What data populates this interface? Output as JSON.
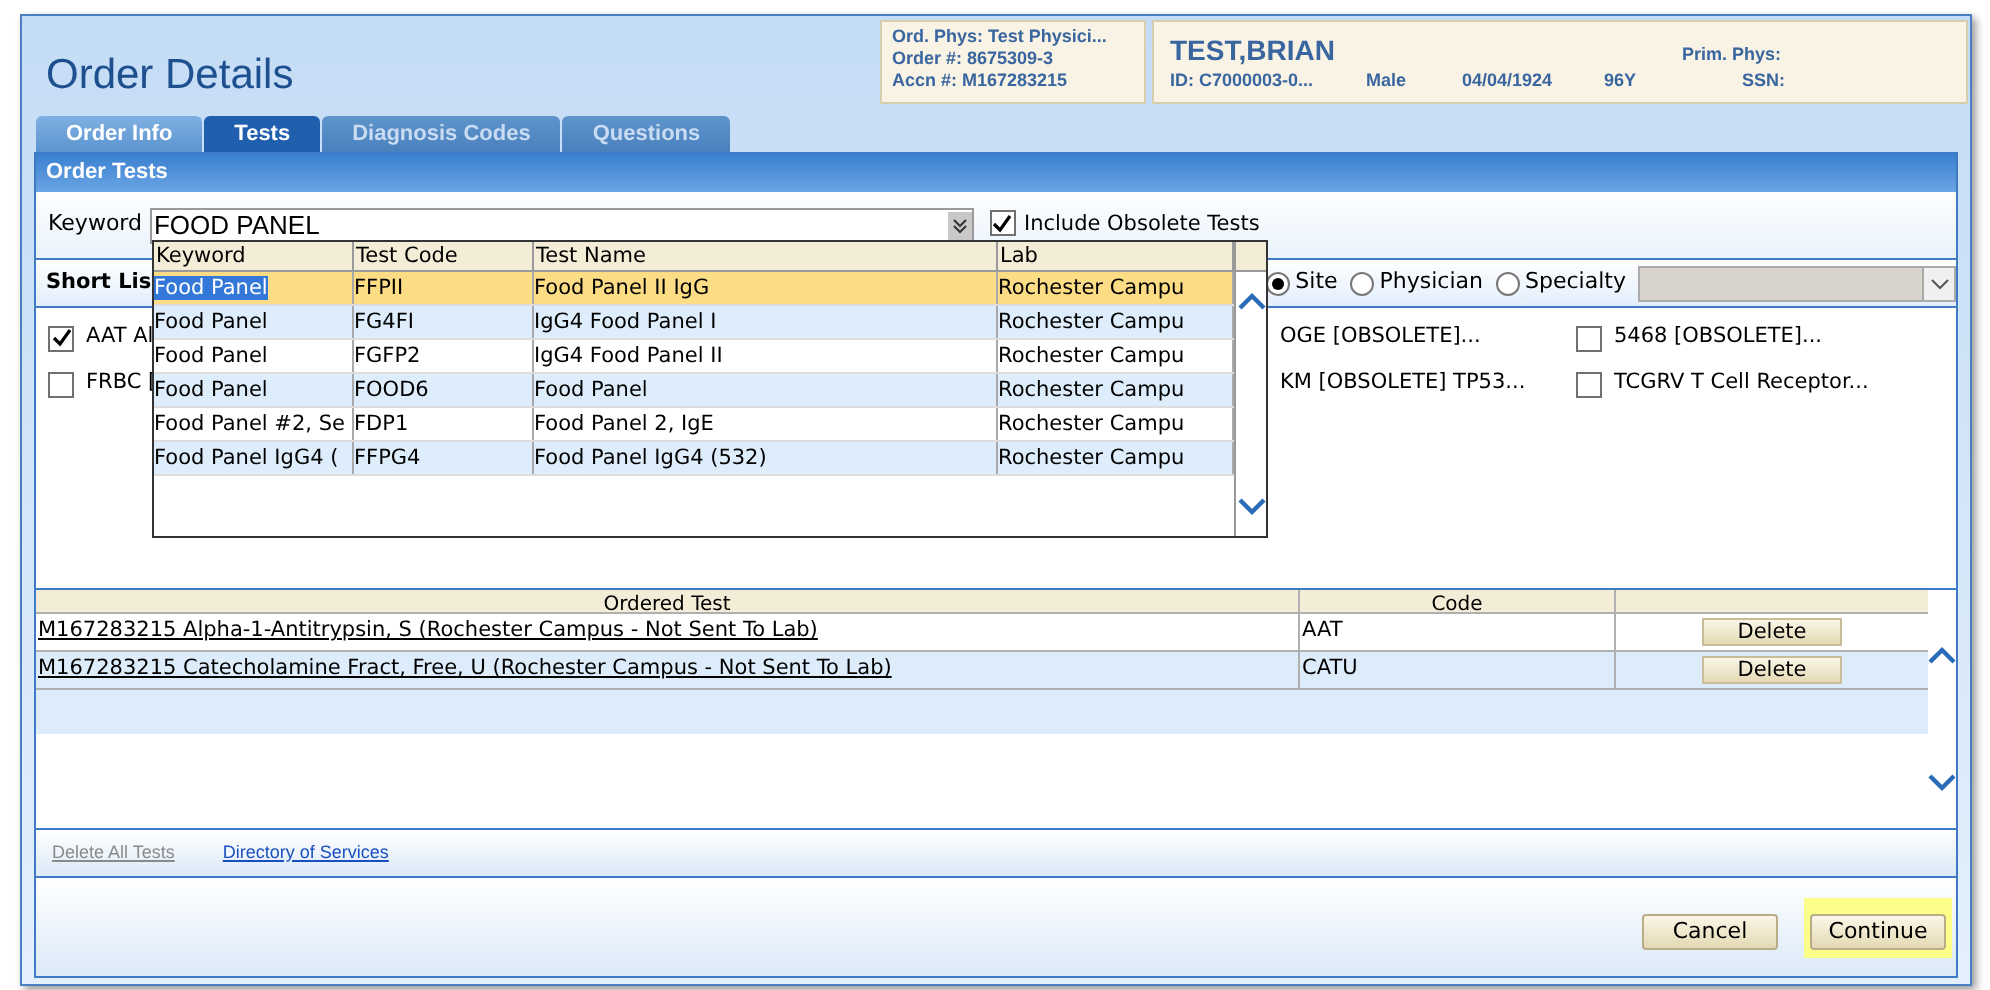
{
  "header": {
    "title": "Order Details",
    "order_card": [
      "Ord. Phys: Test Physici...",
      "Order #: 8675309-3",
      "Accn #: M167283215"
    ],
    "patient": {
      "name": "TEST,BRIAN",
      "id": "ID:  C7000003-0...",
      "sex": "Male",
      "dob": "04/04/1924",
      "age": "96Y",
      "prim_phys_label": "Prim. Phys:",
      "ssn_label": "SSN:"
    }
  },
  "tabs": [
    {
      "label": "Order Info",
      "selected": false,
      "disabled": false
    },
    {
      "label": "Tests",
      "selected": true,
      "disabled": false
    },
    {
      "label": "Diagnosis Codes",
      "selected": false,
      "disabled": true
    },
    {
      "label": "Questions",
      "selected": false,
      "disabled": true
    }
  ],
  "section_title": "Order Tests",
  "keyword": {
    "label": "Keyword",
    "value": "FOOD PANEL"
  },
  "include_obsolete": {
    "label": "Include Obsolete Tests",
    "checked": true
  },
  "short_list": {
    "label": "Short Lis",
    "filters": [
      {
        "label": "Site",
        "selected": true
      },
      {
        "label": "Physician",
        "selected": false
      },
      {
        "label": "Specialty",
        "selected": false
      }
    ],
    "columns": [
      [
        {
          "label": "AAT Al",
          "checked": true
        },
        {
          "label": "FRBC [",
          "checked": false
        }
      ],
      [
        {
          "label": "OGE [OBSOLETE]..."
        },
        {
          "label": "KM [OBSOLETE] TP53..."
        }
      ],
      [
        {
          "label": "5468 [OBSOLETE]...",
          "checked": false
        },
        {
          "label": "TCGRV T Cell Receptor...",
          "checked": false
        }
      ]
    ]
  },
  "dropdown": {
    "columns": [
      "Keyword",
      "Test Code",
      "Test Name",
      "Lab"
    ],
    "rows": [
      {
        "cells": [
          "Food Panel",
          "FFPII",
          "Food Panel II IgG",
          "Rochester Campu"
        ],
        "selected": true
      },
      {
        "cells": [
          "Food Panel",
          "FG4FI",
          "IgG4 Food Panel I",
          "Rochester Campu"
        ],
        "selected": false
      },
      {
        "cells": [
          "Food Panel",
          "FGFP2",
          "IgG4 Food Panel II",
          "Rochester Campu"
        ],
        "selected": false
      },
      {
        "cells": [
          "Food Panel",
          "FOOD6",
          "Food Panel",
          "Rochester Campu"
        ],
        "selected": false
      },
      {
        "cells": [
          "Food Panel #2, Se",
          "FDP1",
          "Food Panel 2, IgE",
          "Rochester Campu"
        ],
        "selected": false
      },
      {
        "cells": [
          "Food Panel IgG4 (",
          "FFPG4",
          "Food Panel IgG4 (532)",
          "Rochester Campu"
        ],
        "selected": false
      }
    ]
  },
  "ordered_tests": {
    "columns": [
      "Ordered Test",
      "Code"
    ],
    "rows": [
      {
        "test": "M167283215 Alpha-1-Antitrypsin, S (Rochester Campus - Not Sent To Lab)",
        "code": "AAT",
        "action": "Delete"
      },
      {
        "test": "M167283215 Catecholamine Fract, Free, U (Rochester Campus - Not Sent To Lab)",
        "code": "CATU",
        "action": "Delete"
      }
    ]
  },
  "links": [
    {
      "label": "Delete All Tests",
      "disabled": true
    },
    {
      "label": "Directory of Services",
      "disabled": false
    }
  ],
  "buttons": [
    {
      "label": "Cancel",
      "focused": false
    },
    {
      "label": "Continue",
      "focused": true
    }
  ]
}
